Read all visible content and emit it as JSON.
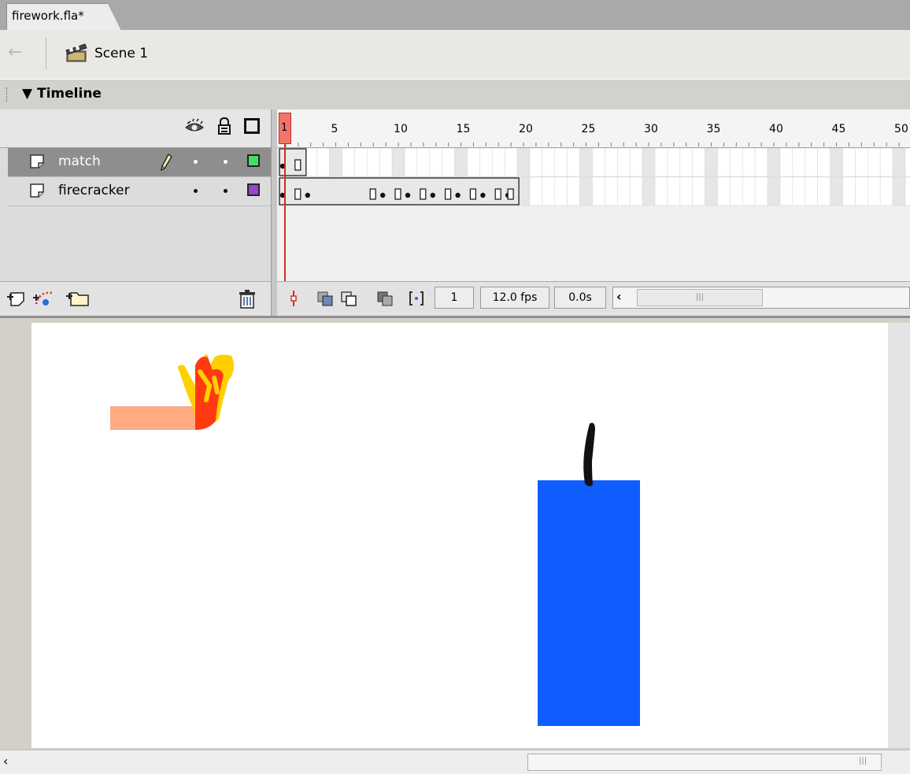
{
  "document": {
    "tab_label": "firework.fla*"
  },
  "scene_bar": {
    "scene_label": "Scene 1"
  },
  "timeline": {
    "title": "Timeline",
    "layers": [
      {
        "name": "match",
        "selected": true,
        "editing": true,
        "outline_color": "#44dd66"
      },
      {
        "name": "firecracker",
        "selected": false,
        "editing": false,
        "outline_color": "#9944cc"
      }
    ],
    "ruler_labels": [
      "1",
      "5",
      "10",
      "15",
      "20",
      "25",
      "30",
      "35",
      "40",
      "45",
      "50"
    ],
    "current_frame": "1",
    "frame_rate": "12.0 fps",
    "elapsed_time": "0.0s",
    "frames": {
      "match": {
        "span": [
          1,
          2
        ],
        "keyframes": [
          1
        ]
      },
      "firecracker": {
        "span": [
          1,
          19
        ],
        "keyframes": [
          1,
          3,
          9,
          11,
          13,
          15,
          17,
          19
        ]
      }
    }
  },
  "colors": {
    "match_stick": "#ffaa80",
    "flame_outer": "#ffd000",
    "flame_inner": "#ff3a10",
    "firecracker_body": "#0f5cff",
    "fuse": "#111111",
    "playhead": "#e03a2a"
  }
}
